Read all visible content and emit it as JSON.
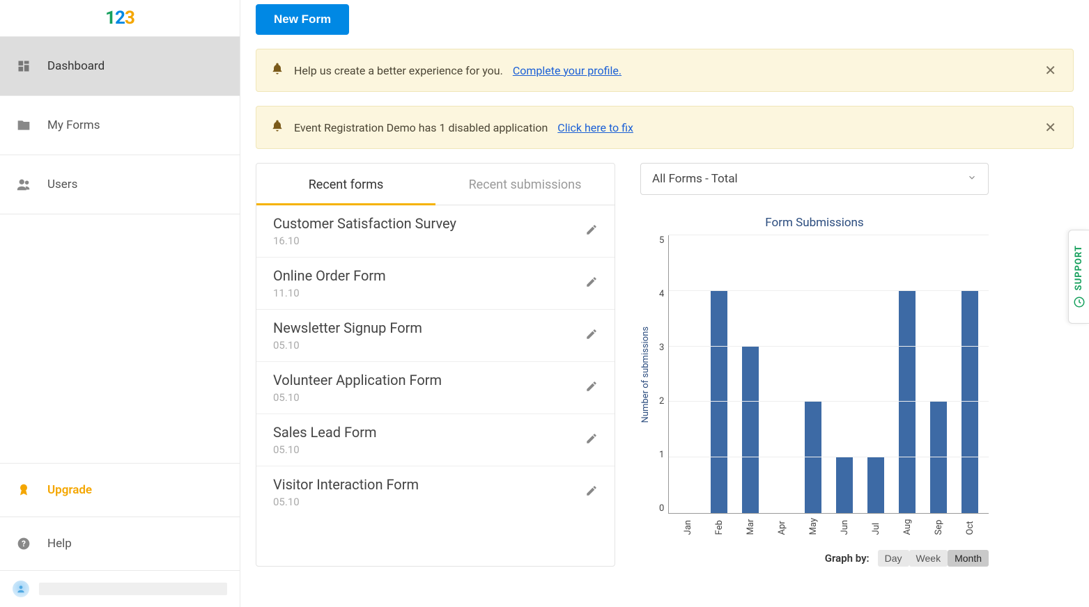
{
  "sidebar": {
    "items": [
      {
        "label": "Dashboard"
      },
      {
        "label": "My Forms"
      },
      {
        "label": "Users"
      }
    ],
    "upgrade_label": "Upgrade",
    "help_label": "Help"
  },
  "header": {
    "new_form_label": "New Form"
  },
  "banners": [
    {
      "text": "Help us create a better experience for you.",
      "link_text": "Complete your profile."
    },
    {
      "text": "Event Registration Demo has 1 disabled application",
      "link_text": "Click here to fix"
    }
  ],
  "tabs": {
    "recent_forms": "Recent forms",
    "recent_submissions": "Recent submissions"
  },
  "recent_forms": [
    {
      "title": "Customer Satisfaction Survey",
      "date": "16.10"
    },
    {
      "title": "Online Order Form",
      "date": "11.10"
    },
    {
      "title": "Newsletter Signup Form",
      "date": "05.10"
    },
    {
      "title": "Volunteer Application Form",
      "date": "05.10"
    },
    {
      "title": "Sales Lead Form",
      "date": "05.10"
    },
    {
      "title": "Visitor Interaction Form",
      "date": "05.10"
    }
  ],
  "chart_dropdown": {
    "selected": "All Forms - Total"
  },
  "graph_by": {
    "label": "Graph by:",
    "options": [
      "Day",
      "Week",
      "Month"
    ],
    "active": "Month"
  },
  "support_label": "SUPPORT",
  "chart_data": {
    "type": "bar",
    "title": "Form Submissions",
    "ylabel": "Number of submissions",
    "xlabel": "",
    "ylim": [
      0,
      5
    ],
    "y_ticks": [
      0,
      1,
      2,
      3,
      4,
      5
    ],
    "categories": [
      "Jan",
      "Feb",
      "Mar",
      "Apr",
      "May",
      "Jun",
      "Jul",
      "Aug",
      "Sep",
      "Oct"
    ],
    "values": [
      0,
      4,
      3,
      0,
      2,
      1,
      1,
      4,
      2,
      4
    ]
  }
}
